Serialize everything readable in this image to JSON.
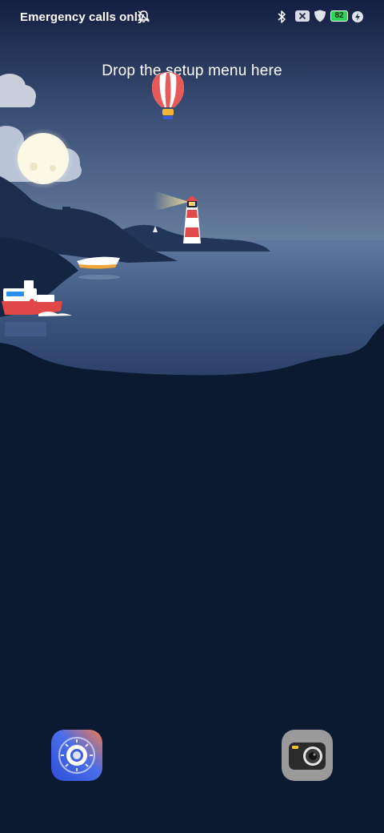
{
  "status_bar": {
    "carrier": "Emergency calls only",
    "battery_level": "82",
    "icons": [
      "bell-off-icon",
      "bluetooth-icon",
      "no-sim-icon",
      "shield-icon",
      "battery-icon",
      "charging-icon"
    ]
  },
  "home": {
    "hint": "Drop the setup menu here"
  },
  "dock": {
    "apps": [
      {
        "icon": "settings-icon"
      },
      {
        "icon": "camera-icon"
      }
    ]
  },
  "colors": {
    "sky_top": "#19264a",
    "sky_bottom": "#5a6f8e",
    "sea": "#3e5a82",
    "land": "#0b1a30",
    "battery_green": "#2fd35a"
  }
}
